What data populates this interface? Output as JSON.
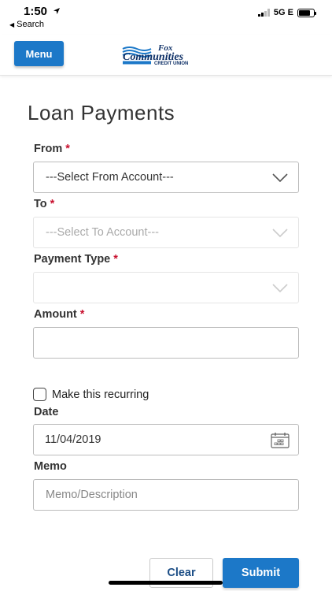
{
  "status_bar": {
    "time": "1:50",
    "back_label": "Search",
    "network": "5G E"
  },
  "header": {
    "menu_label": "Menu",
    "logo_line1": "Fox",
    "logo_line2": "Communities",
    "logo_line3": "CREDIT UNION"
  },
  "page": {
    "title": "Loan Payments"
  },
  "form": {
    "from": {
      "label": "From",
      "required_mark": "*",
      "value": "---Select From Account---"
    },
    "to": {
      "label": "To",
      "required_mark": "*",
      "value": "---Select To Account---"
    },
    "payment_type": {
      "label": "Payment Type",
      "required_mark": "*",
      "value": ""
    },
    "amount": {
      "label": "Amount",
      "required_mark": "*",
      "value": "",
      "placeholder": ""
    },
    "recurring": {
      "label": "Make this recurring",
      "checked": false
    },
    "date": {
      "label": "Date",
      "value": "11/04/2019"
    },
    "memo": {
      "label": "Memo",
      "value": "",
      "placeholder": "Memo/Description"
    }
  },
  "actions": {
    "clear_label": "Clear",
    "submit_label": "Submit"
  },
  "colors": {
    "primary": "#1c78c8",
    "required": "#c8102e",
    "logo_navy": "#0d2f66"
  }
}
